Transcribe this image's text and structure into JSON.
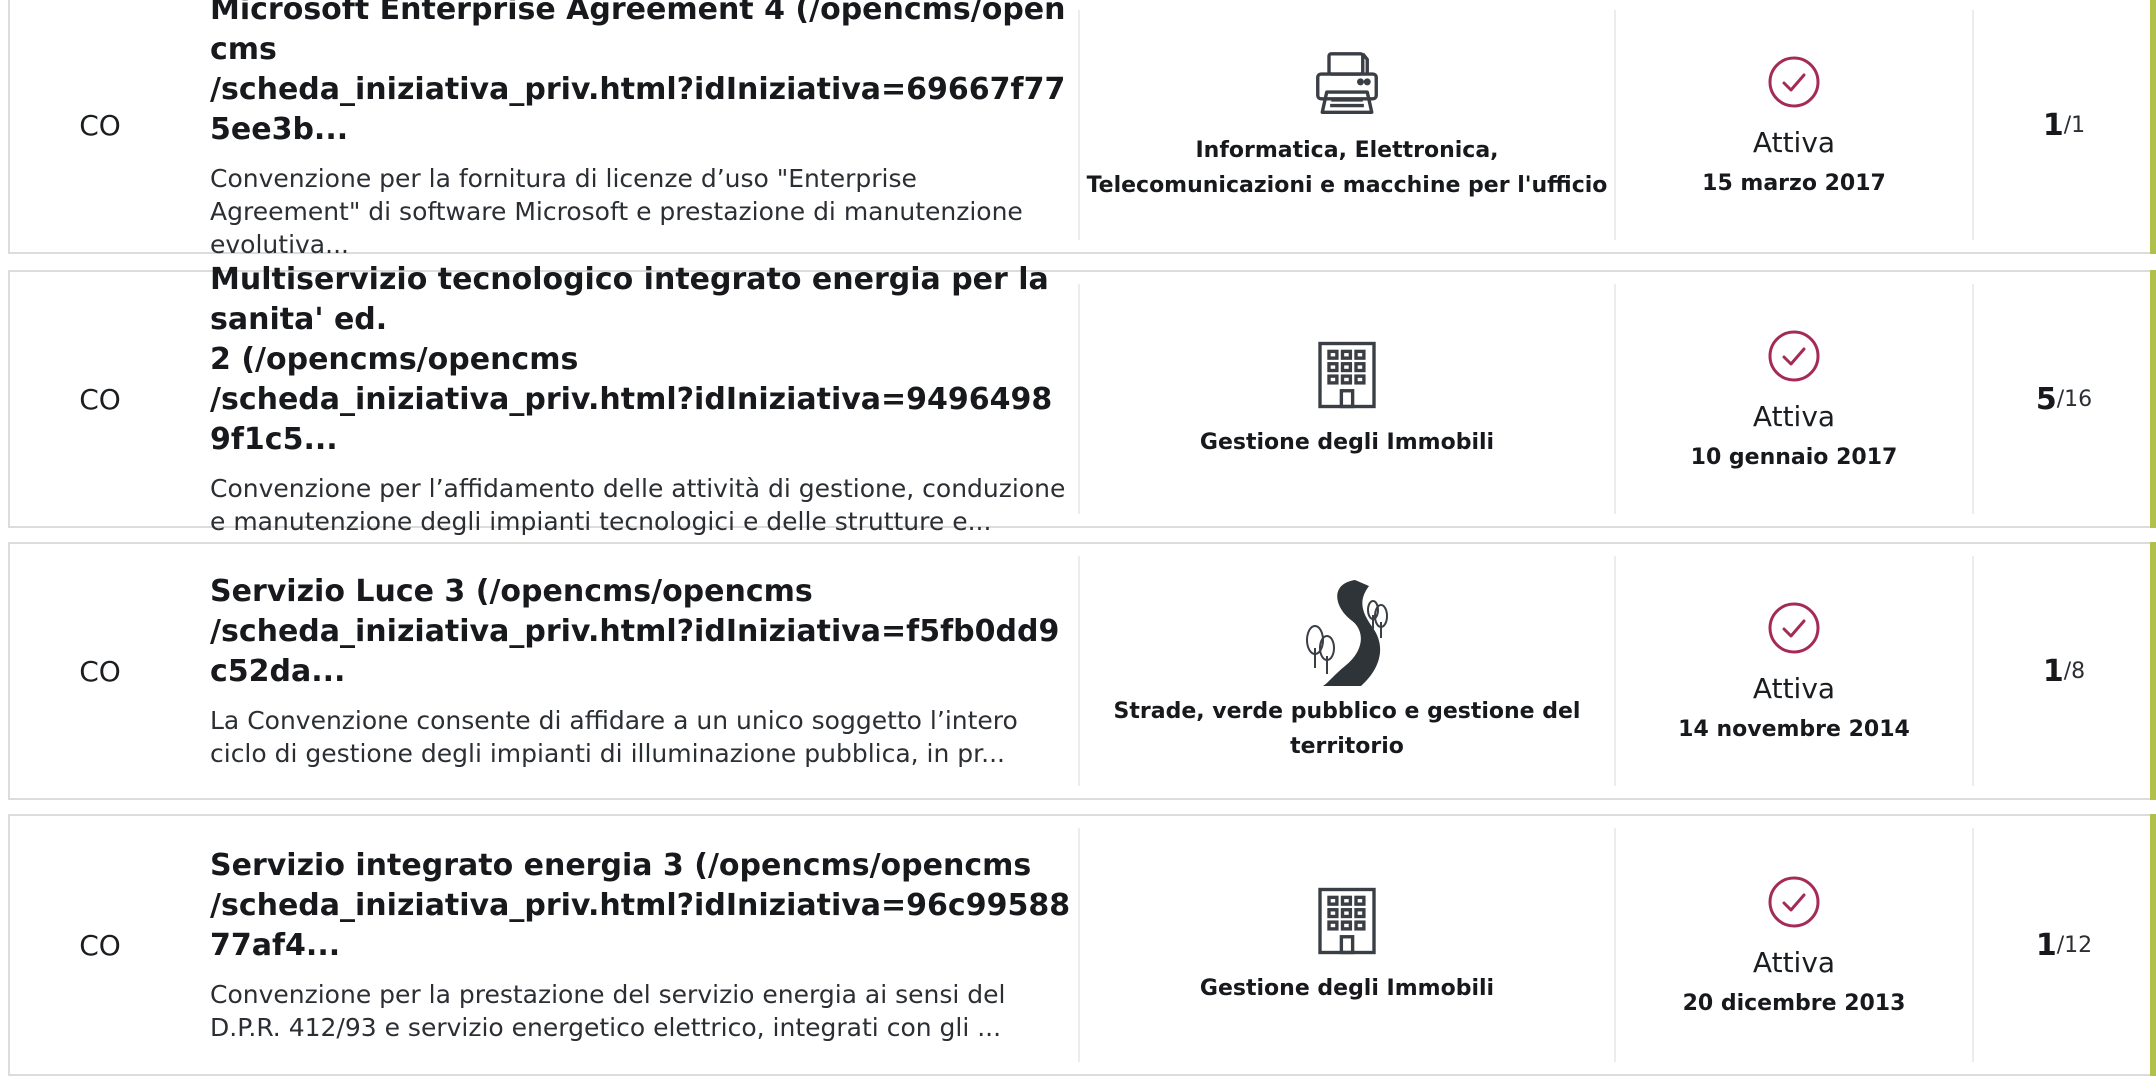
{
  "accent_color": "#b1c04b",
  "status_color": "#a42b58",
  "rows": [
    {
      "type": "CO",
      "title": "Microsoft Enterprise Agreement 4 (/opencms/opencms\n/scheda_iniziativa_priv.html?idIniziativa=69667f775ee3b...",
      "description": "Convenzione per la fornitura di licenze d’uso \"Enterprise Agreement\" di software Microsoft e prestazione di manutenzione evolutiva...",
      "category_icon": "printer-icon",
      "category": "Informatica, Elettronica, Telecomunicazioni e macchine per l'ufficio",
      "status": "Attiva",
      "date": "15 marzo 2017",
      "lot_current": "1",
      "lot_total": "/1"
    },
    {
      "type": "CO",
      "title": "Multiservizio tecnologico integrato energia per la sanita' ed.\n2 (/opencms/opencms\n/scheda_iniziativa_priv.html?idIniziativa=94964989f1c5...",
      "description": "Convenzione per l’affidamento delle attività di gestione, conduzione e manutenzione degli impianti tecnologici e delle strutture e...",
      "category_icon": "building-icon",
      "category": "Gestione degli Immobili",
      "status": "Attiva",
      "date": "10 gennaio 2017",
      "lot_current": "5",
      "lot_total": "/16"
    },
    {
      "type": "CO",
      "title": "Servizio Luce 3 (/opencms/opencms\n/scheda_iniziativa_priv.html?idIniziativa=f5fb0dd9c52da...",
      "description": "La Convenzione consente di affidare a un unico soggetto l’intero ciclo di gestione degli impianti di illuminazione pubblica, in pr...",
      "category_icon": "road-trees-icon",
      "category": "Strade, verde pubblico e gestione del territorio",
      "status": "Attiva",
      "date": "14 novembre 2014",
      "lot_current": "1",
      "lot_total": "/8"
    },
    {
      "type": "CO",
      "title": "Servizio integrato energia 3 (/opencms/opencms\n/scheda_iniziativa_priv.html?idIniziativa=96c9958877af4...",
      "description": "Convenzione per la prestazione del servizio energia ai sensi del D.P.R. 412/93 e servizio energetico elettrico, integrati con gli ...",
      "category_icon": "building-icon",
      "category": "Gestione degli Immobili",
      "status": "Attiva",
      "date": "20 dicembre 2013",
      "lot_current": "1",
      "lot_total": "/12"
    }
  ]
}
